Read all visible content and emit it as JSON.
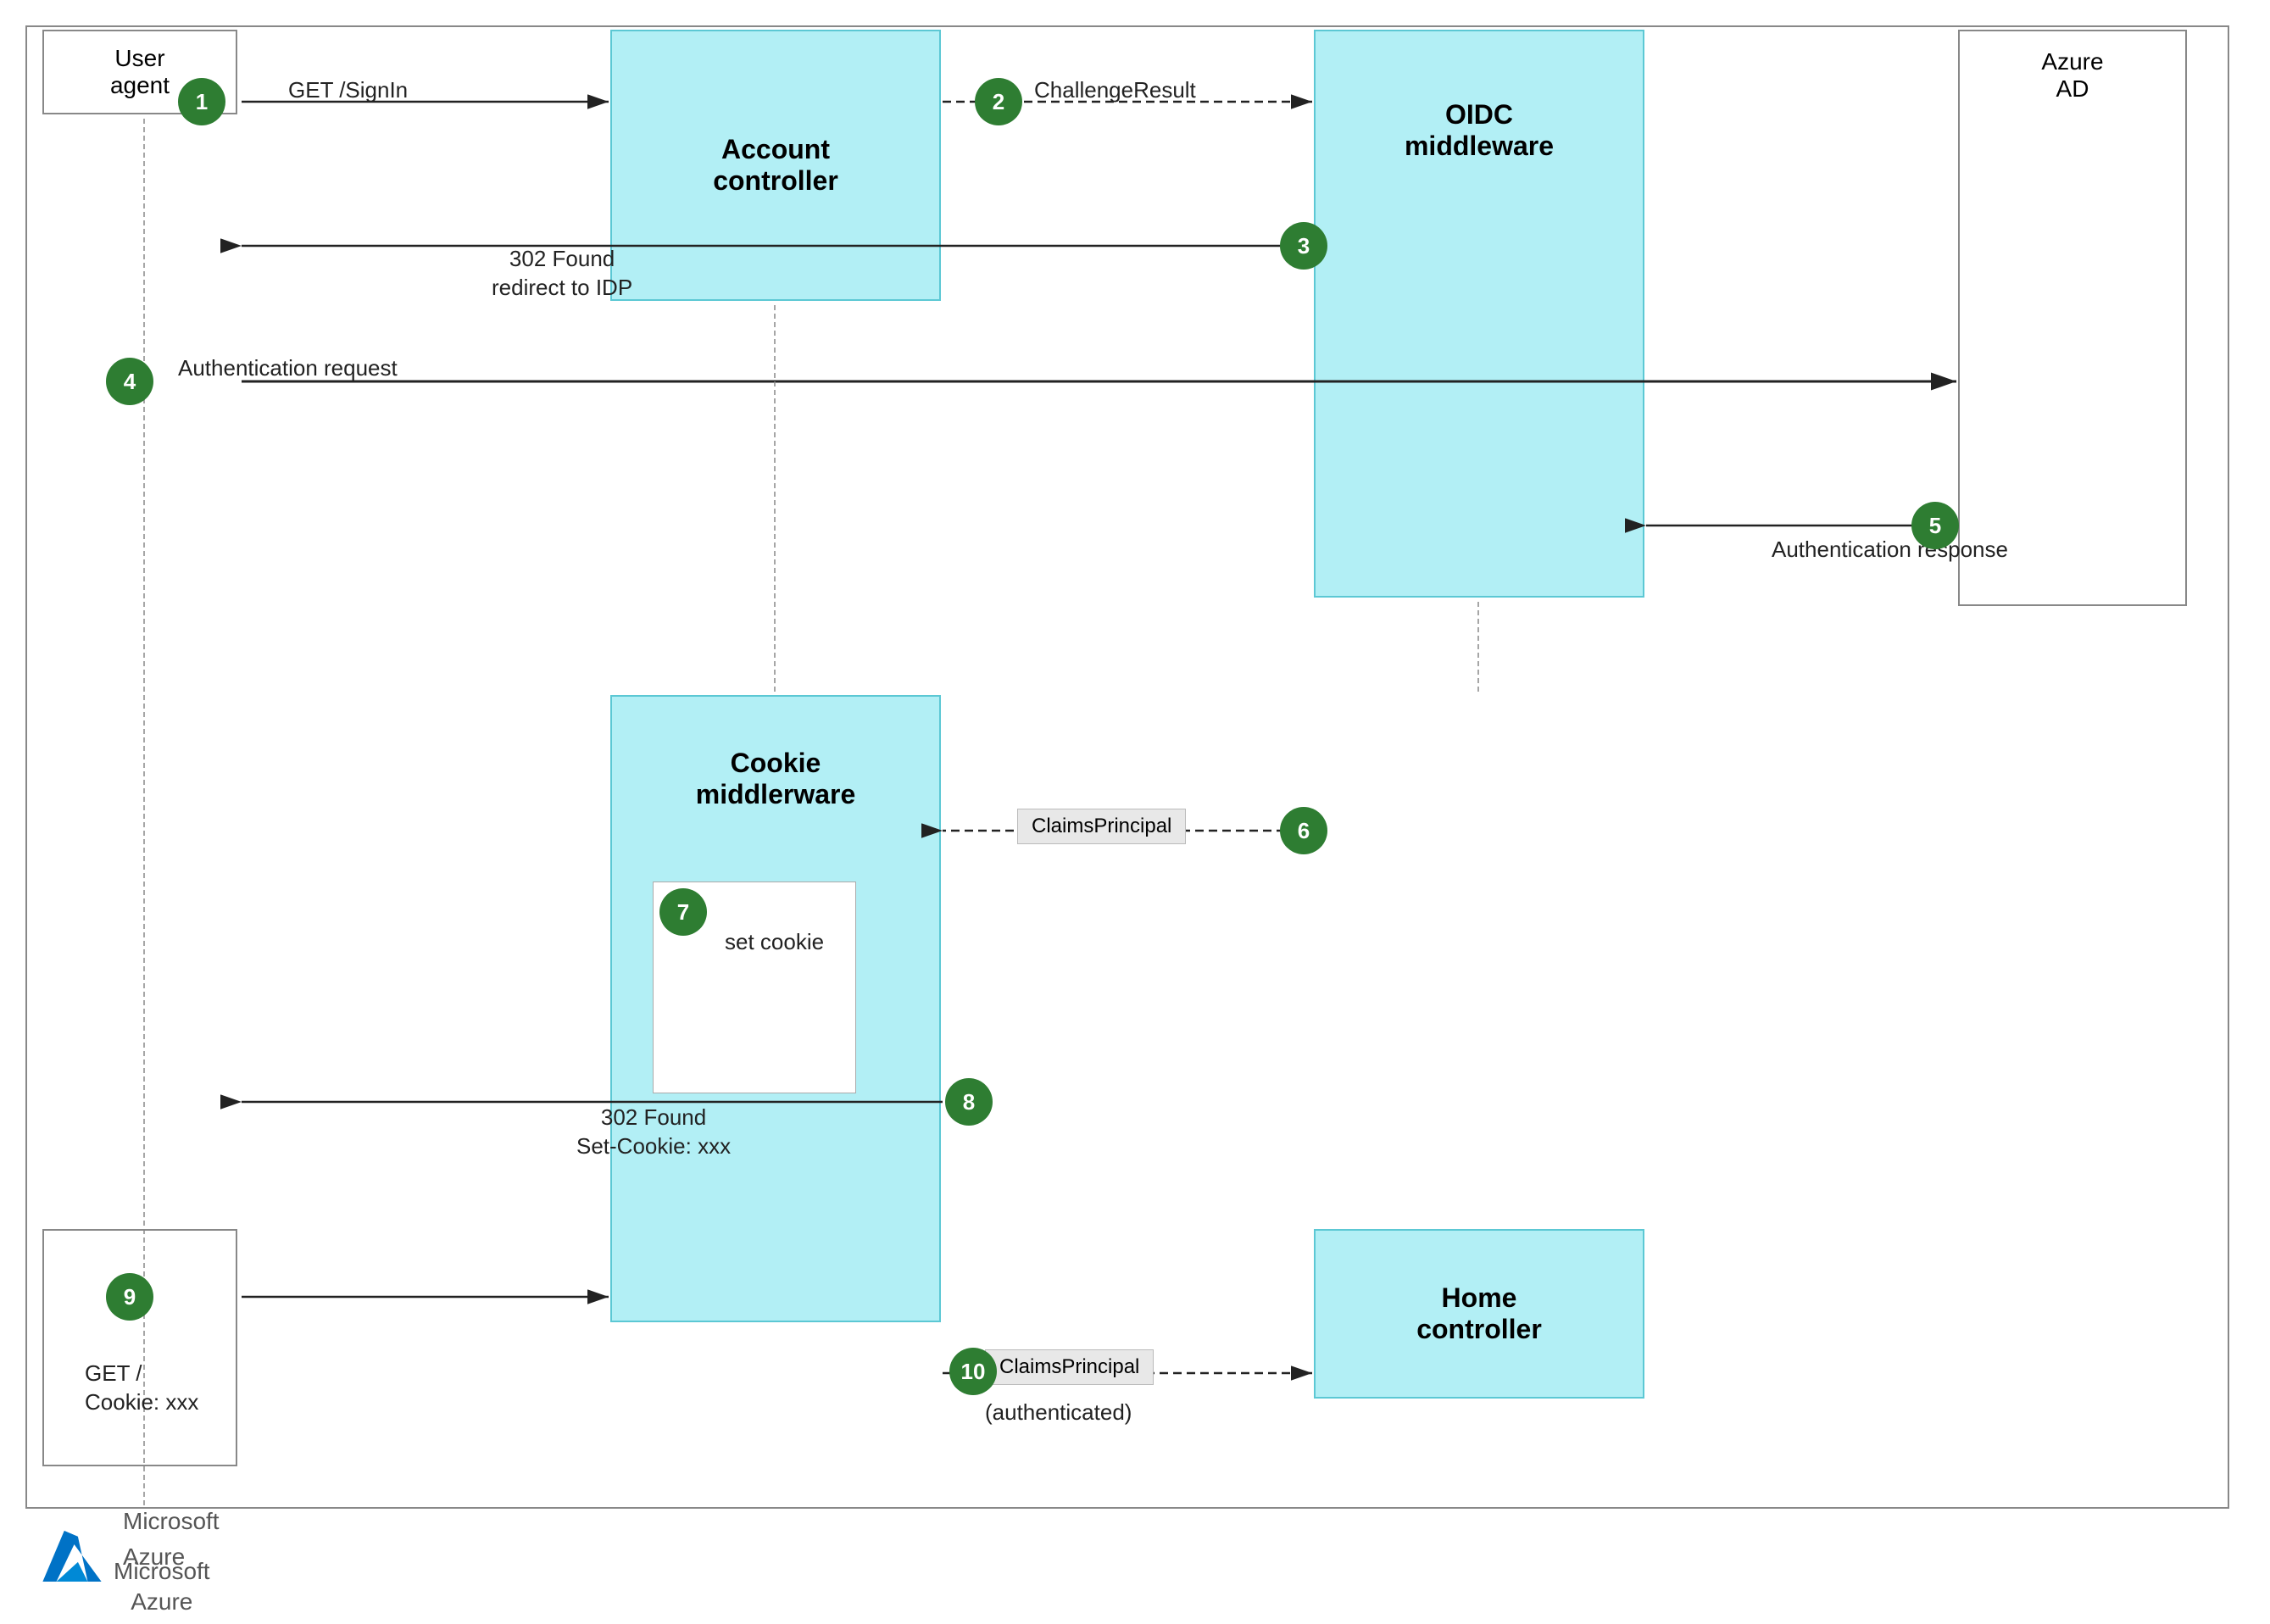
{
  "actors": {
    "user_agent": "User\nagent",
    "account_controller": "Account\ncontroller",
    "oidc_middleware": "OIDC\nmiddleware",
    "azure_ad": "Azure\nAD",
    "cookie_middleware": "Cookie\nmiddlerware",
    "home_controller": "Home\ncontroller"
  },
  "steps": {
    "1": "1",
    "2": "2",
    "3": "3",
    "4": "4",
    "5": "5",
    "6": "6",
    "7": "7",
    "8": "8",
    "9": "9",
    "10": "10"
  },
  "labels": {
    "get_signin": "GET /SignIn",
    "challenge_result": "ChallengeResult",
    "redirect_302": "302 Found\nredirect to IDP",
    "auth_request": "Authentication request",
    "auth_response": "Authentication\nresponse",
    "claims_principal_6": "ClaimsPrincipal",
    "set_cookie": "set\ncookie",
    "found_302": "302 Found\nSet-Cookie: xxx",
    "get_cookie": "GET /\nCookie: xxx",
    "claims_principal_10": "ClaimsPrincipal",
    "authenticated": "(authenticated)"
  },
  "brand": {
    "name": "Microsoft\nAzure"
  }
}
